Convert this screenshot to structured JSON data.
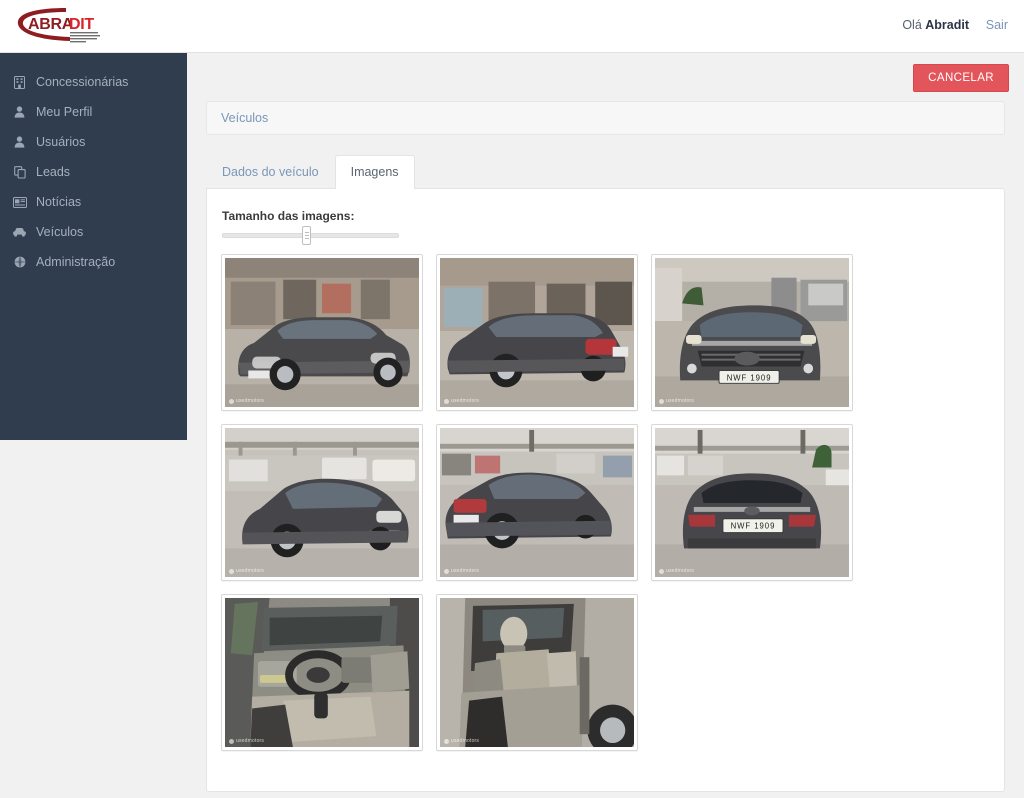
{
  "header": {
    "logo_main": "ABRA",
    "logo_accent": "DIT",
    "logo_sub": "ASSOCIAÇÃO BRASILEIRA DOS DISTRIBUIDORES TOYOTA",
    "greeting_prefix": "Olá",
    "user_name": "Abradit",
    "logout_label": "Sair"
  },
  "sidebar": {
    "items": [
      {
        "label": "Concessionárias",
        "icon": "building-icon"
      },
      {
        "label": "Meu Perfil",
        "icon": "user-icon"
      },
      {
        "label": "Usuários",
        "icon": "user-icon"
      },
      {
        "label": "Leads",
        "icon": "clipboard-icon"
      },
      {
        "label": "Notícias",
        "icon": "newspaper-icon"
      },
      {
        "label": "Veículos",
        "icon": "car-icon"
      },
      {
        "label": "Administração",
        "icon": "globe-icon"
      }
    ]
  },
  "toolbar": {
    "cancel_label": "CANCELAR"
  },
  "breadcrumb": {
    "label": "Veículos"
  },
  "tabs": [
    {
      "label": "Dados do veículo",
      "active": false
    },
    {
      "label": "Imagens",
      "active": true
    }
  ],
  "panel": {
    "size_label": "Tamanho das imagens:",
    "slider": {
      "value_percent": 48,
      "min": 0,
      "max": 100
    }
  },
  "gallery": {
    "watermark": "usedmotors",
    "images": [
      {
        "alt": "Toyota Corolla cinza - vista frontal esquerda na oficina",
        "view": "front-left-garage",
        "plate": ""
      },
      {
        "alt": "Toyota Corolla cinza - vista traseira esquerda",
        "view": "rear-left-garage",
        "plate": ""
      },
      {
        "alt": "Toyota Corolla cinza - vista frontal",
        "view": "front-plate",
        "plate": "NWF 1909"
      },
      {
        "alt": "Toyota Corolla cinza - vista frontal direita no pátio",
        "view": "front-right-lot",
        "plate": ""
      },
      {
        "alt": "Toyota Corolla cinza - vista traseira direita",
        "view": "rear-right-lot",
        "plate": ""
      },
      {
        "alt": "Toyota Corolla cinza - vista traseira",
        "view": "rear-plate",
        "plate": "NWF 1909"
      },
      {
        "alt": "Interior - painel e volante",
        "view": "interior-dash",
        "plate": ""
      },
      {
        "alt": "Interior - bancos traseiros",
        "view": "interior-rear-seats",
        "plate": ""
      }
    ]
  },
  "colors": {
    "sidebar_bg": "#2f3d4e",
    "accent_red": "#e2555a",
    "link_blue": "#7b96b8",
    "page_bg": "#f1f1f1"
  }
}
